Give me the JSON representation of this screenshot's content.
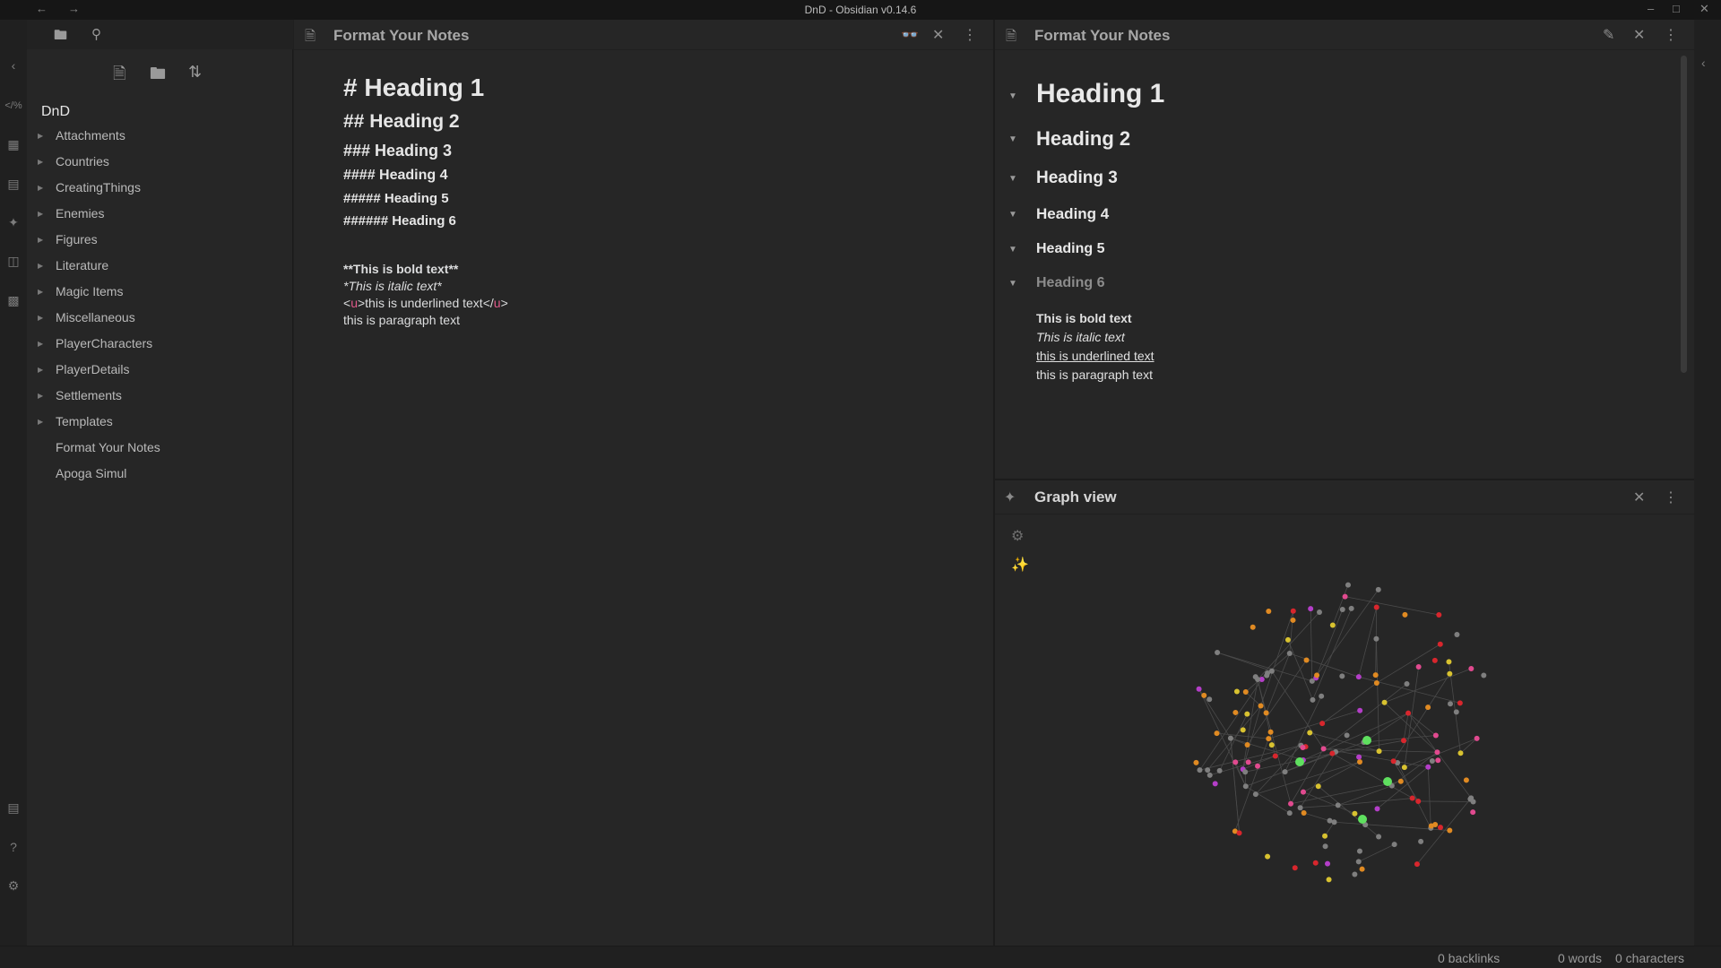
{
  "window": {
    "title": "DnD - Obsidian v0.14.6"
  },
  "vault": {
    "name": "DnD"
  },
  "file_tree": [
    {
      "label": "Attachments",
      "folder": true
    },
    {
      "label": "Countries",
      "folder": true
    },
    {
      "label": "CreatingThings",
      "folder": true
    },
    {
      "label": "Enemies",
      "folder": true
    },
    {
      "label": "Figures",
      "folder": true
    },
    {
      "label": "Literature",
      "folder": true
    },
    {
      "label": "Magic Items",
      "folder": true
    },
    {
      "label": "Miscellaneous",
      "folder": true
    },
    {
      "label": "PlayerCharacters",
      "folder": true
    },
    {
      "label": "PlayerDetails",
      "folder": true
    },
    {
      "label": "Settlements",
      "folder": true
    },
    {
      "label": "Templates",
      "folder": true
    },
    {
      "label": "Format Your Notes",
      "folder": false
    },
    {
      "label": "Apoga Simul",
      "folder": false
    }
  ],
  "editor": {
    "title": "Format Your Notes",
    "lines": {
      "h1": "# Heading 1",
      "h2": "## Heading 2",
      "h3": "### Heading 3",
      "h4": "#### Heading 4",
      "h5": "##### Heading 5",
      "h6": "###### Heading 6",
      "bold": "**This is bold text**",
      "italic": "*This is italic text*",
      "underline_open_lt": "<",
      "underline_open_tag": "u",
      "underline_open_gt": ">",
      "underline_text": "this is underlined text",
      "underline_close_lt": "</",
      "underline_close_tag": "u",
      "underline_close_gt": ">",
      "paragraph": "this is paragraph text"
    }
  },
  "preview": {
    "title": "Format Your Notes",
    "headings": [
      "Heading 1",
      "Heading 2",
      "Heading 3",
      "Heading 4",
      "Heading 5",
      "Heading 6"
    ],
    "bold": "This is bold text",
    "italic": "This is italic text",
    "underline": "this is underlined text",
    "paragraph": "this is paragraph text"
  },
  "graph": {
    "title": "Graph view",
    "node_colors": {
      "default": "#7f7f7f",
      "magenta": "#b43ec8",
      "pink": "#e14a8f",
      "red": "#d8262d",
      "yellow": "#d8c230",
      "orange": "#e08a22",
      "green": "#5fe05f"
    }
  },
  "status": {
    "backlinks": "0 backlinks",
    "words": "0 words",
    "characters": "0 characters"
  }
}
